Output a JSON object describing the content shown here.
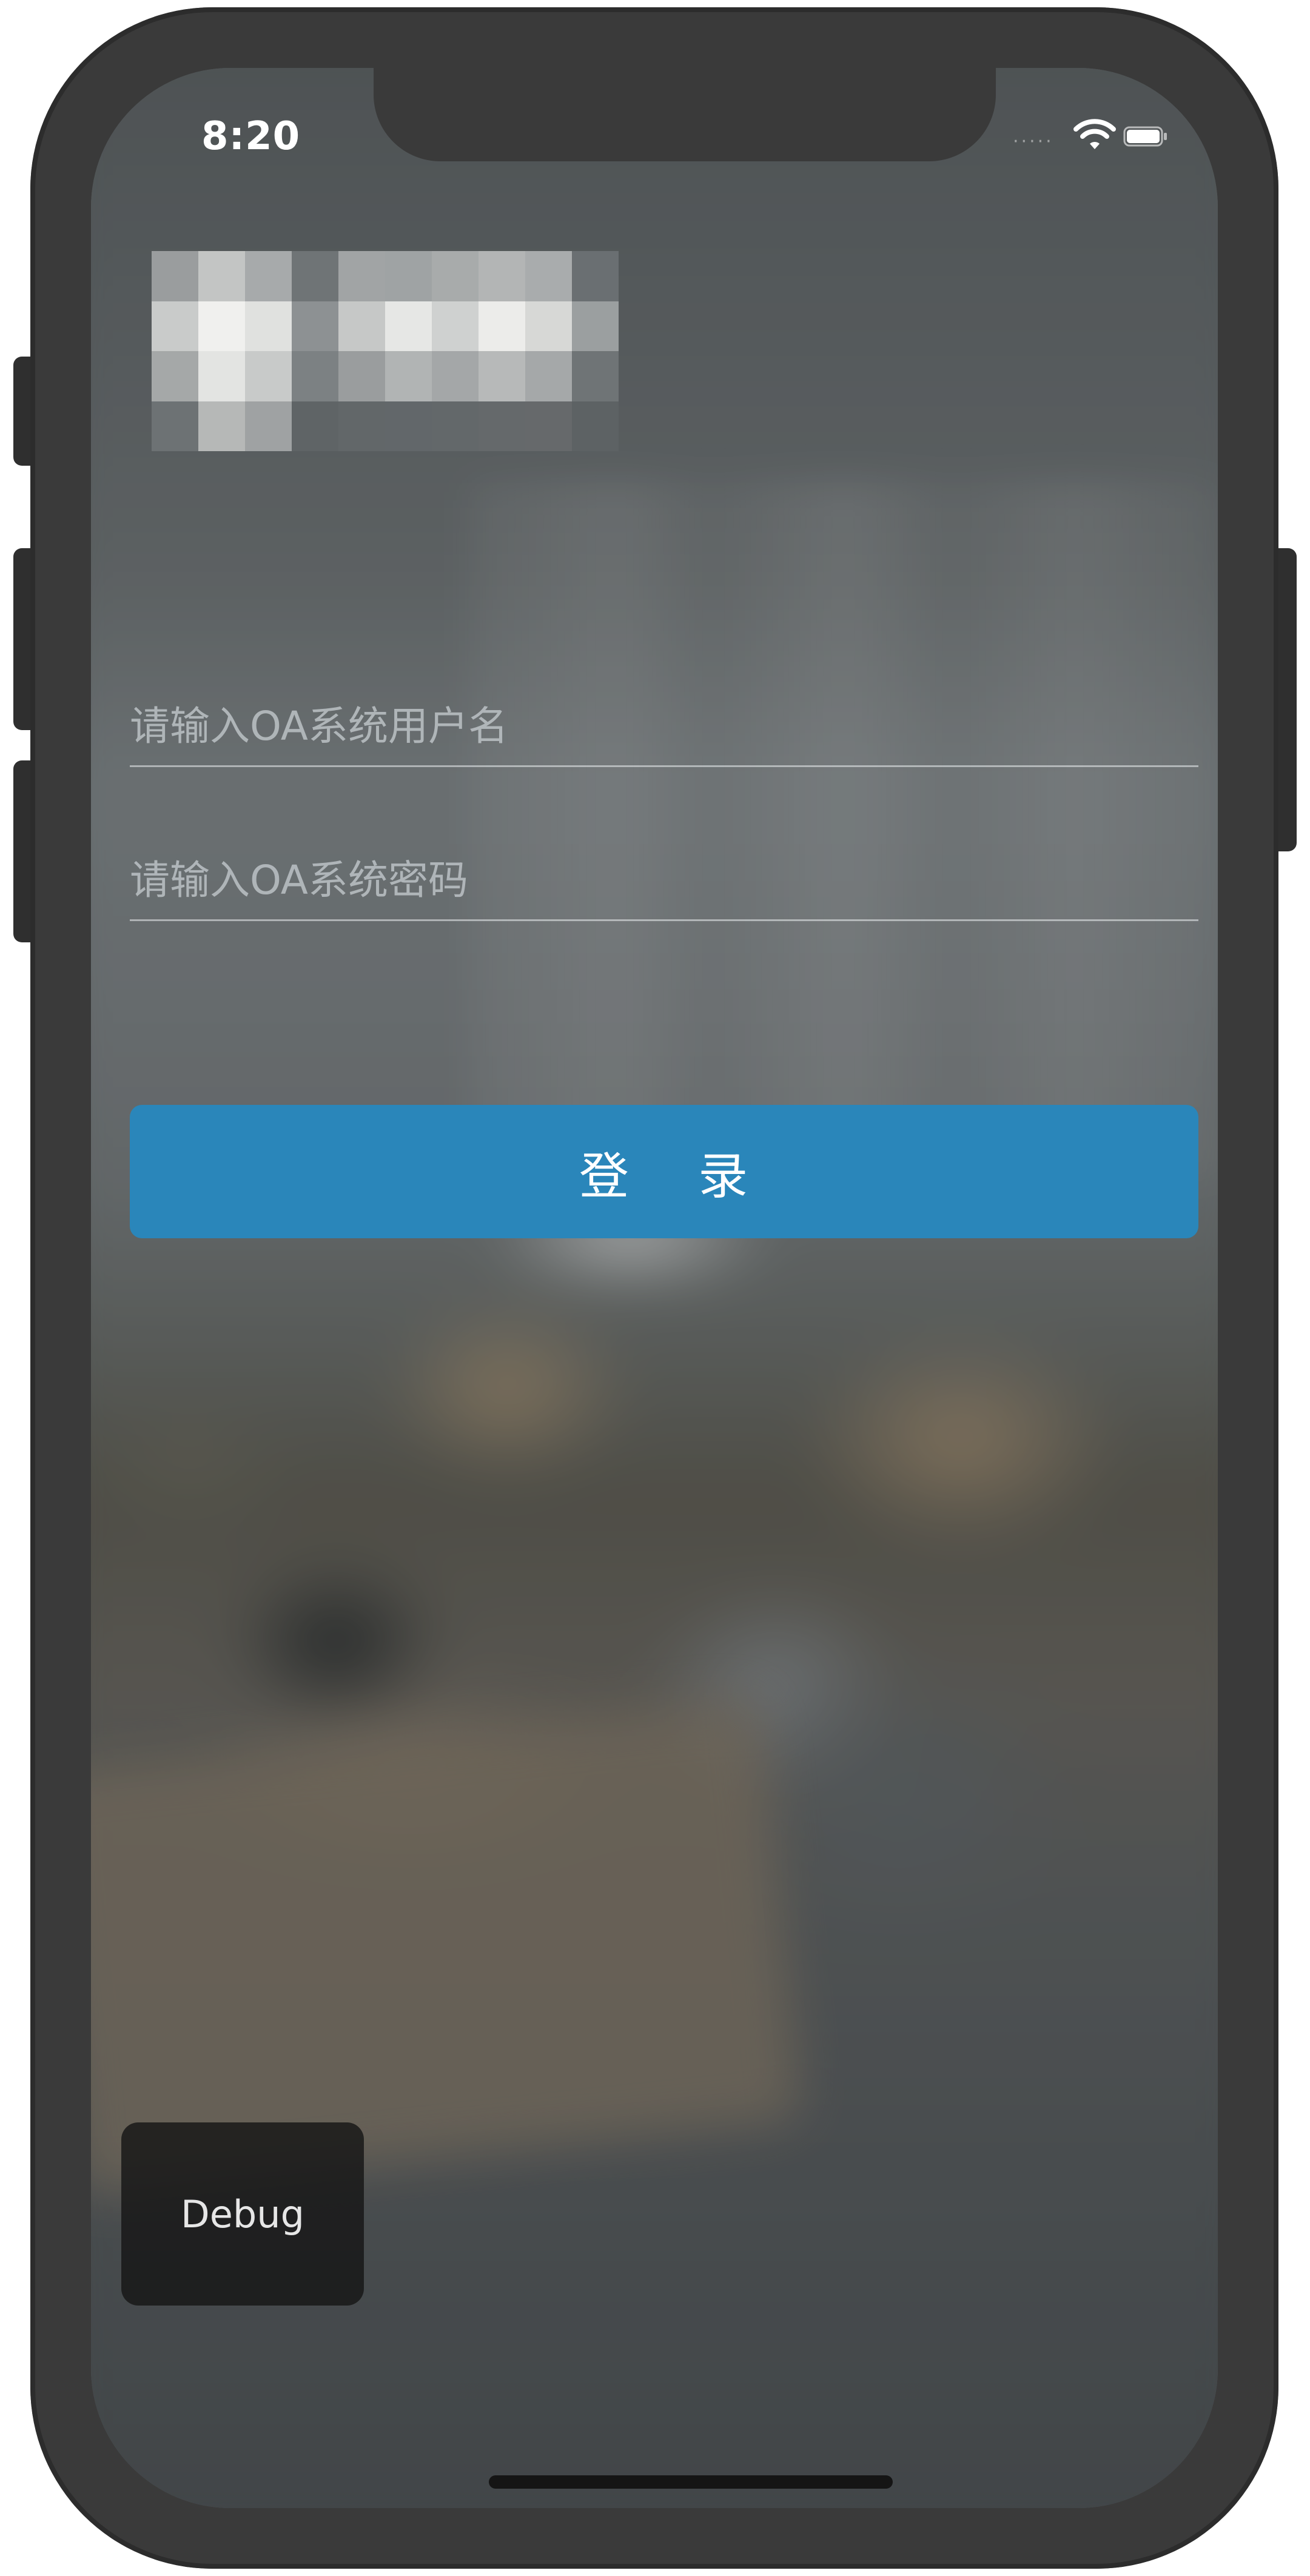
{
  "status_bar": {
    "time": "8:20",
    "icons": [
      "signal-dots",
      "wifi-icon",
      "battery-icon"
    ]
  },
  "logo": {
    "style": "pixelated-mosaic",
    "mosaic": [
      [
        "#9a9d9e",
        "#c3c5c4",
        "#a7aaab",
        "#6f7476",
        "#a1a4a5",
        "#9fa3a4",
        "#a8abab",
        "#b3b5b5",
        "#a9acad",
        "#6a6f72"
      ],
      [
        "#c9cbca",
        "#f0f0ee",
        "#e0e1df",
        "#8d9193",
        "#c6c8c7",
        "#e6e7e5",
        "#cfd1d0",
        "#ececea",
        "#d7d8d6",
        "#9b9fa0"
      ],
      [
        "#a5a8a8",
        "#e3e4e2",
        "#c8cac9",
        "#7c8183",
        "#9a9d9e",
        "#b1b4b4",
        "#a4a7a8",
        "#b7b9b9",
        "#a5a8a9",
        "#6f7476"
      ],
      [
        "#6d7274",
        "#b6b8b7",
        "#9fa2a3",
        "#5f6466",
        "#626769",
        "#62676a",
        "#63686a",
        "#65696b",
        "#66696b",
        "#5d6264"
      ]
    ]
  },
  "login_form": {
    "username_placeholder": "请输入OA系统用户名",
    "password_placeholder": "请输入OA系统密码",
    "username_value": "",
    "password_value": "",
    "login_label": "登    录"
  },
  "debug": {
    "label": "Debug"
  },
  "colors": {
    "login_button": "#2a86ba",
    "device_frame": "#3a3a3a",
    "debug_button": "#161616"
  }
}
